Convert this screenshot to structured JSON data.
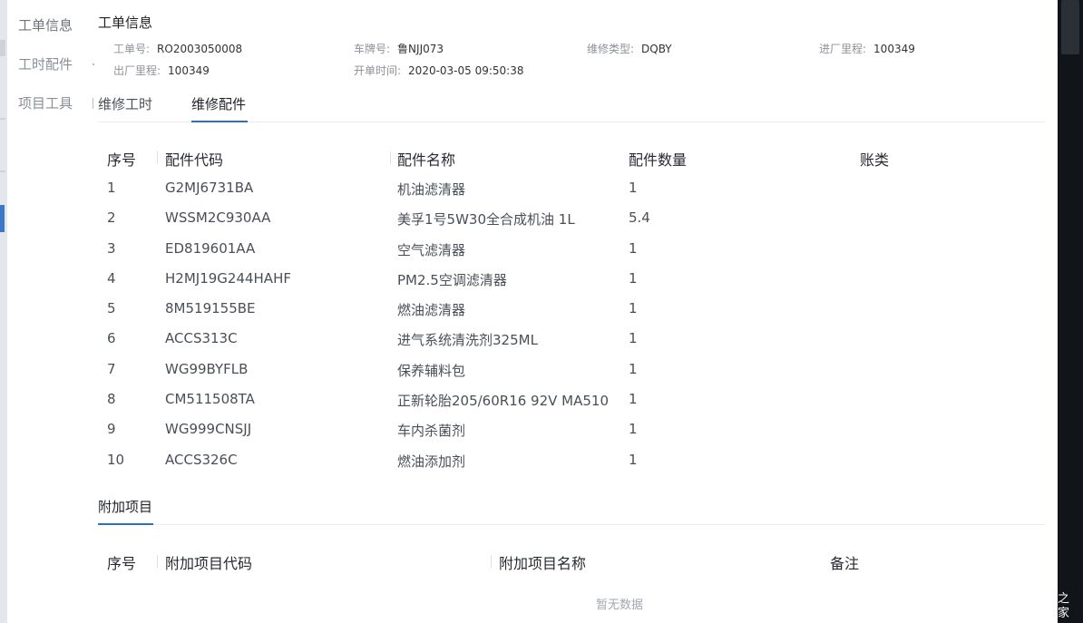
{
  "anchor_nav": {
    "items": [
      {
        "label": "工单信息"
      },
      {
        "label": "工时配件"
      },
      {
        "label": "项目工具"
      }
    ]
  },
  "header": {
    "title": "工单信息",
    "fields": [
      {
        "label": "工单号:",
        "value": "RO2003050008"
      },
      {
        "label": "车牌号:",
        "value": "鲁NJJ073"
      },
      {
        "label": "维修类型:",
        "value": "DQBY"
      },
      {
        "label": "进厂里程:",
        "value": "100349"
      },
      {
        "label": "出厂里程:",
        "value": "100349"
      },
      {
        "label": "开单时间:",
        "value": "2020-03-05 09:50:38"
      }
    ]
  },
  "tabs": [
    {
      "label": "维修工时",
      "active": false
    },
    {
      "label": "维修配件",
      "active": true
    }
  ],
  "parts_table": {
    "columns": [
      "序号",
      "配件代码",
      "配件名称",
      "配件数量",
      "账类"
    ],
    "rows": [
      {
        "idx": "1",
        "code": "G2MJ6731BA",
        "name": "机油滤清器",
        "qty": "1",
        "account": ""
      },
      {
        "idx": "2",
        "code": "WSSM2C930AA",
        "name": "美孚1号5W30全合成机油 1L",
        "qty": "5.4",
        "account": ""
      },
      {
        "idx": "3",
        "code": "ED819601AA",
        "name": "空气滤清器",
        "qty": "1",
        "account": ""
      },
      {
        "idx": "4",
        "code": "H2MJ19G244HAHF",
        "name": "PM2.5空调滤清器",
        "qty": "1",
        "account": ""
      },
      {
        "idx": "5",
        "code": "8M519155BE",
        "name": "燃油滤清器",
        "qty": "1",
        "account": ""
      },
      {
        "idx": "6",
        "code": "ACCS313C",
        "name": "进气系统清洗剂325ML",
        "qty": "1",
        "account": ""
      },
      {
        "idx": "7",
        "code": "WG99BYFLB",
        "name": "保养辅料包",
        "qty": "1",
        "account": ""
      },
      {
        "idx": "8",
        "code": "CM511508TA",
        "name": "正新轮胎205/60R16 92V MA510",
        "qty": "1",
        "account": ""
      },
      {
        "idx": "9",
        "code": "WG999CNSJJ",
        "name": "车内杀菌剂",
        "qty": "1",
        "account": ""
      },
      {
        "idx": "10",
        "code": "ACCS326C",
        "name": "燃油添加剂",
        "qty": "1",
        "account": ""
      }
    ]
  },
  "extra_section": {
    "title": "附加项目",
    "columns": [
      "序号",
      "附加项目代码",
      "附加项目名称",
      "备注"
    ],
    "empty_text": "暂无数据"
  },
  "watermark": "之家",
  "colors": {
    "accent": "#2a6fc9",
    "dark_edge": "#111419"
  }
}
